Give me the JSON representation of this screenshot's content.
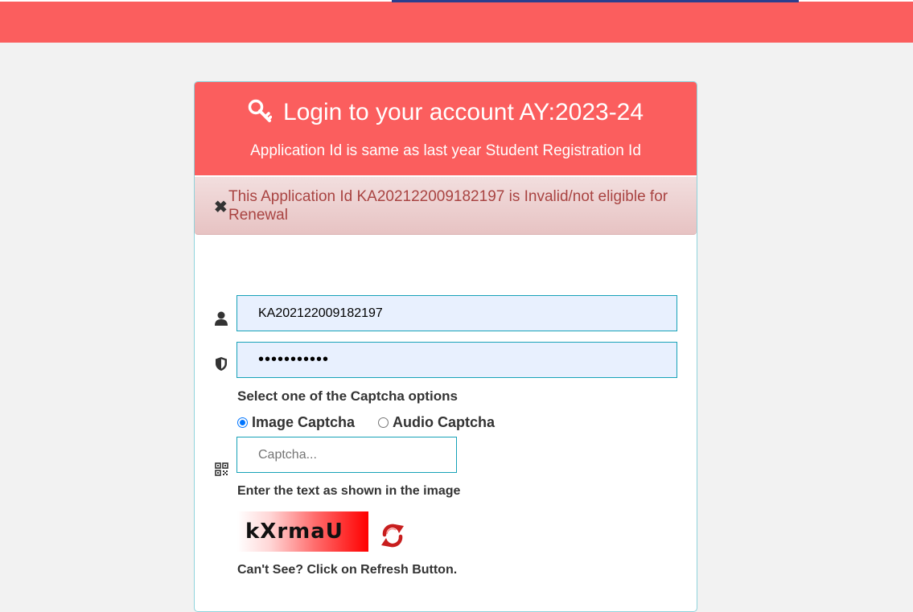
{
  "header": {
    "title": "Login to your account AY:2023-24",
    "subtitle": "Application Id is same as last year Student Registration Id"
  },
  "alert": {
    "close_glyph": "✖",
    "message": "This Application Id KA202122009182197 is Invalid/not eligible for Renewal"
  },
  "form": {
    "application_id_value": "KA202122009182197",
    "password_value": "•••••••••••",
    "captcha_options_label": "Select one of the Captcha options",
    "radio_image_label": "Image Captcha",
    "radio_audio_label": "Audio Captcha",
    "selected_option": "Image Captcha",
    "captcha_placeholder": "Captcha...",
    "captcha_hint": "Enter the text as shown in the image",
    "captcha_text": "kXrmaU",
    "refresh_hint": "Can't See? Click on Refresh Button."
  },
  "icons": {
    "title": "key-icon",
    "user": "user-icon",
    "password": "shield-icon",
    "captcha": "qr-code-icon",
    "refresh": "refresh-icon",
    "close": "close-icon"
  },
  "colors": {
    "accent": "#fb5e5e",
    "input_border": "#17a2b8",
    "alert_text": "#a94442"
  }
}
